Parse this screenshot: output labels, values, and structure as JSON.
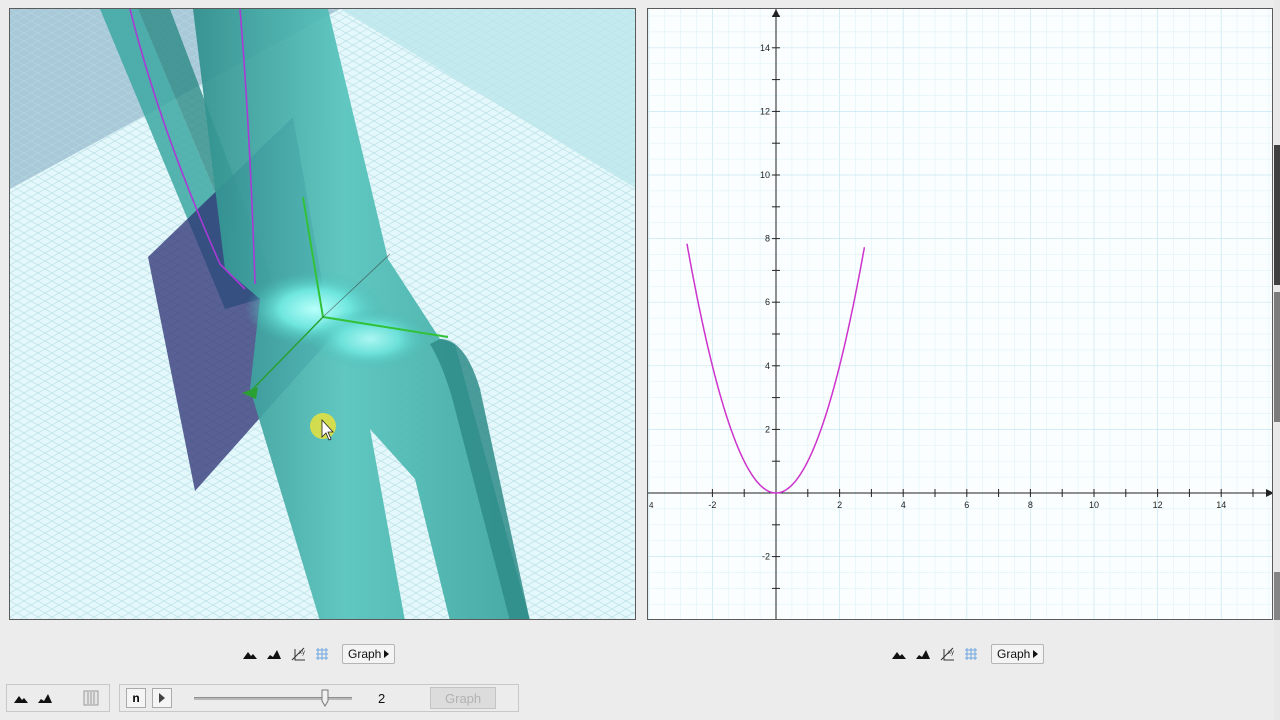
{
  "plot2d": {
    "x_ticks": [
      "-2",
      "2",
      "4",
      "6",
      "8",
      "10",
      "12",
      "14"
    ],
    "x_edge_label": "4",
    "y_ticks": [
      "2",
      "4",
      "6",
      "8",
      "10",
      "12",
      "14",
      "-2"
    ],
    "curve_color": "#cc33cc",
    "function": "y = x^2"
  },
  "colors": {
    "surface": "#41b0aa",
    "plane": "#2b2f72",
    "curve3d": "#a83bd6",
    "axis_green": "#31c23a",
    "cursor_highlight": "#e7e23c"
  },
  "left_toolbar": {
    "graph_label": "Graph",
    "icons": [
      "mountain-left-icon",
      "mountain-right-icon",
      "xy-axes-icon",
      "grid-icon"
    ]
  },
  "right_toolbar": {
    "graph_label": "Graph",
    "icons": [
      "mountain-left-icon",
      "mountain-right-icon",
      "xy-axes-icon",
      "grid-icon"
    ]
  },
  "bottom": {
    "n_label": "n",
    "slider_value": "2",
    "slider_fraction": 0.83,
    "graph_label": "Graph"
  }
}
